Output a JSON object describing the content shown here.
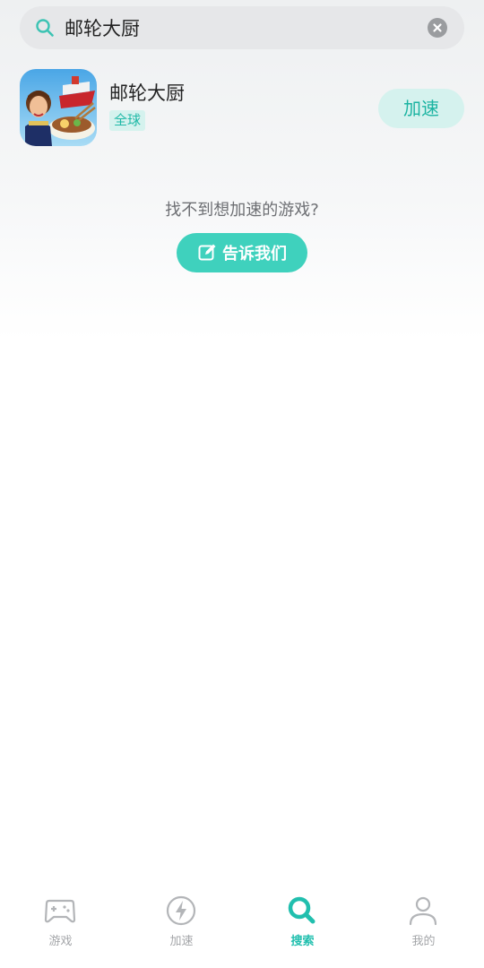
{
  "search": {
    "value": "邮轮大厨",
    "placeholder": ""
  },
  "result": {
    "title": "邮轮大厨",
    "region": "全球",
    "action_label": "加速"
  },
  "not_found": {
    "text": "找不到想加速的游戏?",
    "button_label": "告诉我们"
  },
  "tabs": [
    {
      "label": "游戏",
      "icon": "gamepad-icon",
      "active": false
    },
    {
      "label": "加速",
      "icon": "lightning-icon",
      "active": false
    },
    {
      "label": "搜索",
      "icon": "search-icon",
      "active": true
    },
    {
      "label": "我的",
      "icon": "person-icon",
      "active": false
    }
  ],
  "colors": {
    "accent": "#3fd1bd",
    "accent_text": "#1cb4a2",
    "accent_soft": "#d5f2ee",
    "inactive": "#a4a6a9"
  }
}
